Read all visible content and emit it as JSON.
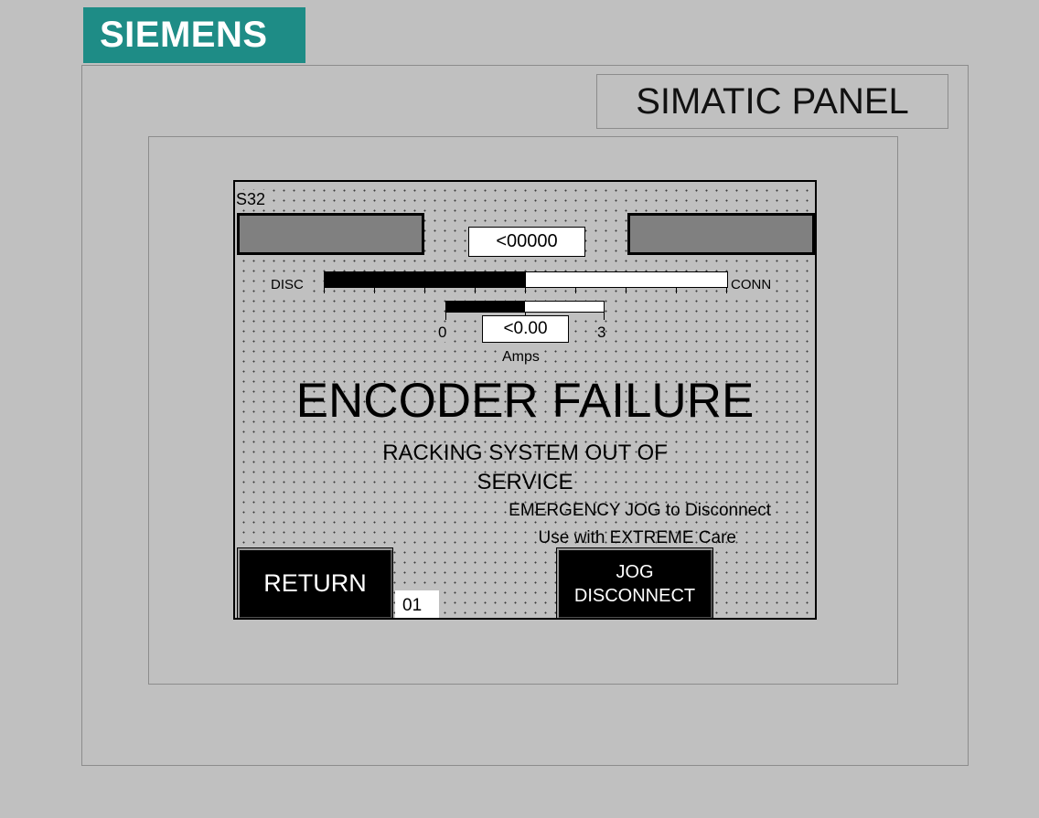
{
  "brand": {
    "logo_text": "SIEMENS",
    "panel_label": "SIMATIC PANEL",
    "logo_color": "#1e8c86"
  },
  "screen": {
    "id": "S32",
    "counter_value": "<00000",
    "position_bar": {
      "left_label": "DISC",
      "right_label": "CONN",
      "fill_fraction": 0.5
    },
    "current_meter": {
      "min_label": "0",
      "max_label": "3",
      "value": "<0.00",
      "unit": "Amps",
      "fill_fraction": 0.5
    },
    "headline": "ENCODER FAILURE",
    "subtitle_line1": "RACKING SYSTEM OUT OF",
    "subtitle_line2": "SERVICE",
    "note_line1": "EMERGENCY JOG to Disconnect",
    "note_line2": "Use with EXTREME Care",
    "buttons": {
      "return_label": "RETURN",
      "jog_line1": "JOG",
      "jog_line2": "DISCONNECT"
    },
    "screen_number": "01"
  }
}
